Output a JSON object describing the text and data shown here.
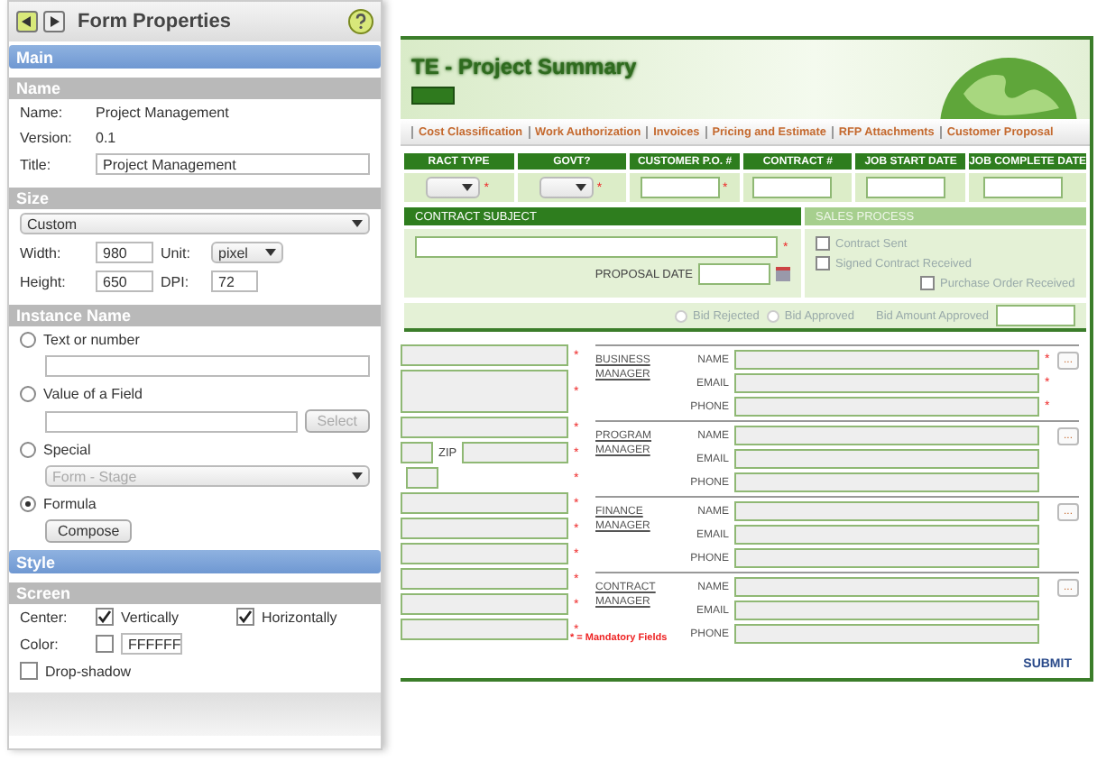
{
  "panel": {
    "title": "Form Properties",
    "main_header": "Main",
    "name_section": {
      "header": "Name",
      "name_label": "Name:",
      "name_value": "Project Management",
      "version_label": "Version:",
      "version_value": "0.1",
      "title_label": "Title:",
      "title_value": "Project Management"
    },
    "size_section": {
      "header": "Size",
      "preset": "Custom",
      "width_label": "Width:",
      "width_value": "980",
      "unit_label": "Unit:",
      "unit_value": "pixel",
      "height_label": "Height:",
      "height_value": "650",
      "dpi_label": "DPI:",
      "dpi_value": "72"
    },
    "instance_section": {
      "header": "Instance Name",
      "options": [
        {
          "label": "Text or number",
          "selected": false,
          "kind": "text"
        },
        {
          "label": "Value of a Field",
          "selected": false,
          "kind": "field",
          "button": "Select"
        },
        {
          "label": "Special",
          "selected": false,
          "kind": "select",
          "value": "Form - Stage"
        },
        {
          "label": "Formula",
          "selected": true,
          "kind": "button",
          "button": "Compose"
        }
      ]
    },
    "style_header": "Style",
    "screen_section": {
      "header": "Screen",
      "center_label": "Center:",
      "checks": [
        {
          "label": "Vertically",
          "checked": true
        },
        {
          "label": "Horizontally",
          "checked": true
        }
      ],
      "color_label": "Color:",
      "color_value": "FFFFFF",
      "drop_shadow": {
        "label": "Drop-shadow",
        "checked": false
      }
    }
  },
  "form": {
    "title": "TE - Project Summary",
    "tabs": [
      {
        "label": "Cost Classification",
        "selected": false
      },
      {
        "label": "Work Authorization",
        "selected": false
      },
      {
        "label": "Invoices",
        "selected": false
      },
      {
        "label": "Pricing and Estimate",
        "selected": false
      },
      {
        "label": "RFP Attachments",
        "selected": false
      },
      {
        "label": "Customer Proposal",
        "selected": false
      }
    ],
    "columns": [
      {
        "label": "RACT TYPE",
        "kind": "select",
        "required": true
      },
      {
        "label": "GOVT?",
        "kind": "select",
        "required": true
      },
      {
        "label": "CUSTOMER P.O. #",
        "kind": "text",
        "required": true
      },
      {
        "label": "CONTRACT #",
        "kind": "text",
        "required": false
      },
      {
        "label": "JOB START DATE",
        "kind": "text",
        "required": false
      },
      {
        "label": "JOB COMPLETE DATE",
        "kind": "text",
        "required": false
      }
    ],
    "subject": {
      "header": "CONTRACT SUBJECT",
      "proposal_label": "PROPOSAL DATE"
    },
    "sales": {
      "header": "SALES PROCESS",
      "checks": [
        {
          "label": "Contract Sent",
          "checked": false
        },
        {
          "label": "Signed Contract Received",
          "checked": false
        },
        {
          "label": "Purchase Order Received",
          "checked": false
        }
      ]
    },
    "bid": {
      "options": [
        {
          "label": "Bid Rejected",
          "selected": false
        },
        {
          "label": "Bid Approved",
          "selected": false
        }
      ],
      "amount_label": "Bid Amount Approved"
    },
    "left_fields": [
      {
        "kind": "text",
        "required": true
      },
      {
        "kind": "area",
        "required": true
      },
      {
        "kind": "text",
        "required": true
      },
      {
        "kind": "zip",
        "required": true,
        "label": "ZIP"
      },
      {
        "kind": "short",
        "required": true
      },
      {
        "kind": "text",
        "required": true
      },
      {
        "kind": "text",
        "required": true
      },
      {
        "kind": "text",
        "required": true
      },
      {
        "kind": "text",
        "required": true
      },
      {
        "kind": "text",
        "required": true
      },
      {
        "kind": "text",
        "required": true
      }
    ],
    "managers": [
      {
        "title": "BUSINESS MANAGER",
        "required": true,
        "fields": [
          "NAME",
          "EMAIL",
          "PHONE"
        ]
      },
      {
        "title": "PROGRAM MANAGER",
        "required": false,
        "fields": [
          "NAME",
          "EMAIL",
          "PHONE"
        ]
      },
      {
        "title": "FINANCE MANAGER",
        "required": false,
        "fields": [
          "NAME",
          "EMAIL",
          "PHONE"
        ]
      },
      {
        "title": "CONTRACT MANAGER",
        "required": false,
        "fields": [
          "NAME",
          "EMAIL",
          "PHONE"
        ]
      }
    ],
    "mandatory_note": "* = Mandatory Fields",
    "submit": "SUBMIT",
    "required_mark": "*",
    "lookup_label": "..."
  }
}
